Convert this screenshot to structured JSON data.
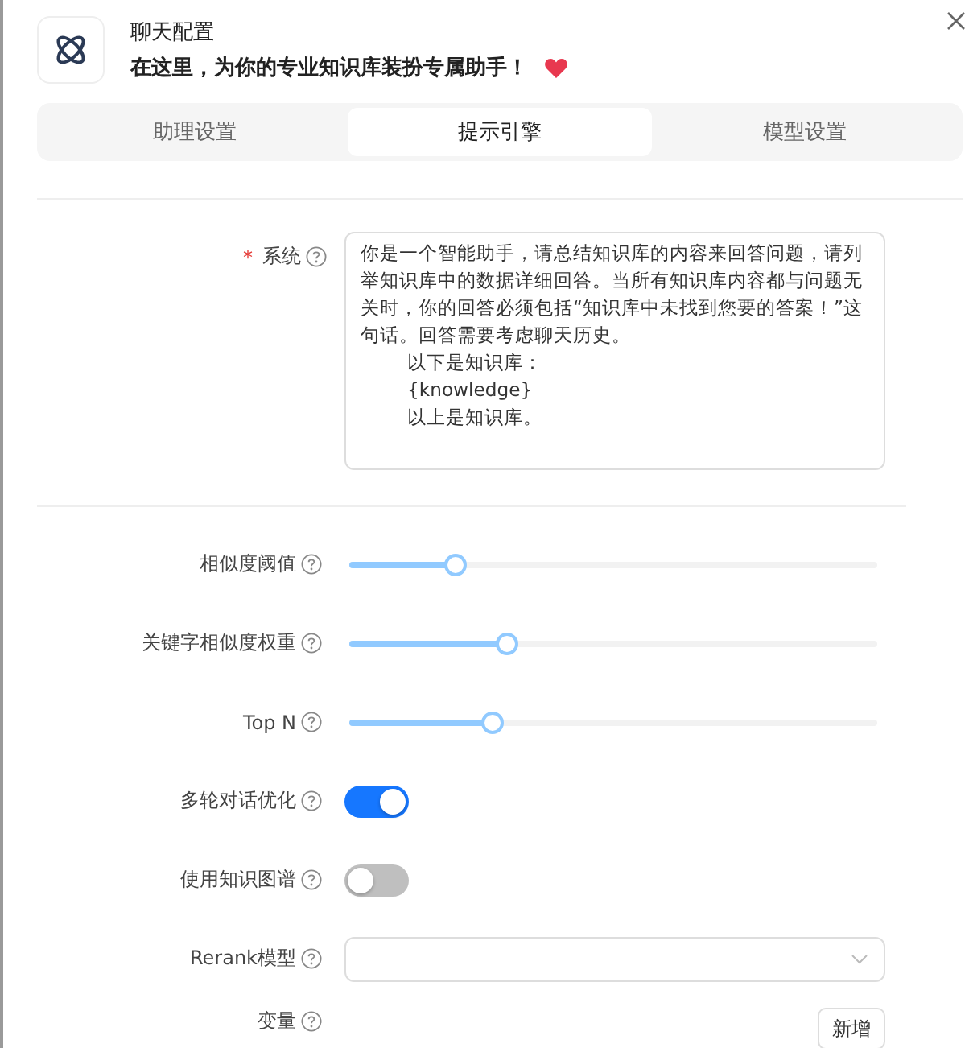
{
  "header": {
    "title": "聊天配置",
    "subtitle": "在这里，为你的专业知识库装扮专属助手！"
  },
  "tabs": [
    {
      "label": "助理设置",
      "selected": false
    },
    {
      "label": "提示引擎",
      "selected": true
    },
    {
      "label": "模型设置",
      "selected": false
    }
  ],
  "system": {
    "label": "系统",
    "required_mark": "*",
    "text": "你是一个智能助手，请总结知识库的内容来回答问题，请列举知识库中的数据详细回答。当所有知识库内容都与问题无关时，你的回答必须包括“知识库中未找到您要的答案！”这句话。回答需要考虑聊天历史。",
    "indented_lines": [
      "以下是知识库：",
      "{knowledge}",
      "以上是知识库。"
    ]
  },
  "settings": [
    {
      "kind": "slider",
      "label": "相似度阈值",
      "level": 0.2
    },
    {
      "kind": "slider",
      "label": "关键字相似度权重",
      "level": 0.3
    },
    {
      "kind": "slider",
      "label": "Top N",
      "level": 0.27
    },
    {
      "kind": "switch",
      "label": "多轮对话优化",
      "on": true
    },
    {
      "kind": "switch",
      "label": "使用知识图谱",
      "on": false
    },
    {
      "kind": "select",
      "label": "Rerank模型"
    },
    {
      "kind": "button",
      "label": "变量",
      "button": "新增"
    }
  ]
}
